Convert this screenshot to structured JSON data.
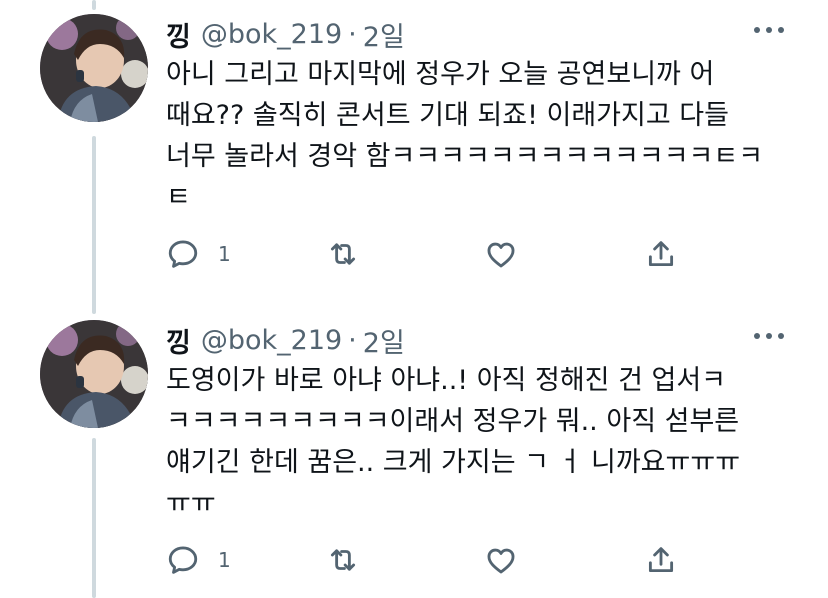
{
  "tweets": [
    {
      "display_name": "낑",
      "handle": "@bok_219",
      "separator": "·",
      "time": "2일",
      "text_lines": [
        "아니 그리고 마지막에 정우가 오늘 공연보니까 어",
        "때요?? 솔직히 콘서트 기대 되죠! 이래가지고 다들",
        "너무 놀라서 경악 함ㅋㅋㅋㅋㅋㅋㅋㅋㅋㅋㅋㅋㅋㅌㅋ",
        "ㅌ"
      ],
      "reply_count": "1",
      "icons": [
        "reply-icon",
        "retweet-icon",
        "like-icon",
        "share-icon"
      ]
    },
    {
      "display_name": "낑",
      "handle": "@bok_219",
      "separator": "·",
      "time": "2일",
      "text_lines": [
        "도영이가 바로 아냐 아냐..! 아직 정해진 건 업서ㅋ",
        "ㅋㅋㅋㅋㅋㅋㅋㅋㅋ이래서 정우가 뭐.. 아직 섣부른",
        "얘기긴 한데 꿈은.. 크게 가지는 ㄱ ㅓ 니까요ㅠㅠㅠ",
        "ㅠㅠ"
      ],
      "reply_count": "1",
      "icons": [
        "reply-icon",
        "retweet-icon",
        "like-icon",
        "share-icon"
      ]
    }
  ],
  "colors": {
    "text": "#0f1419",
    "secondary": "#536471",
    "thread_line": "#cfd9de"
  }
}
